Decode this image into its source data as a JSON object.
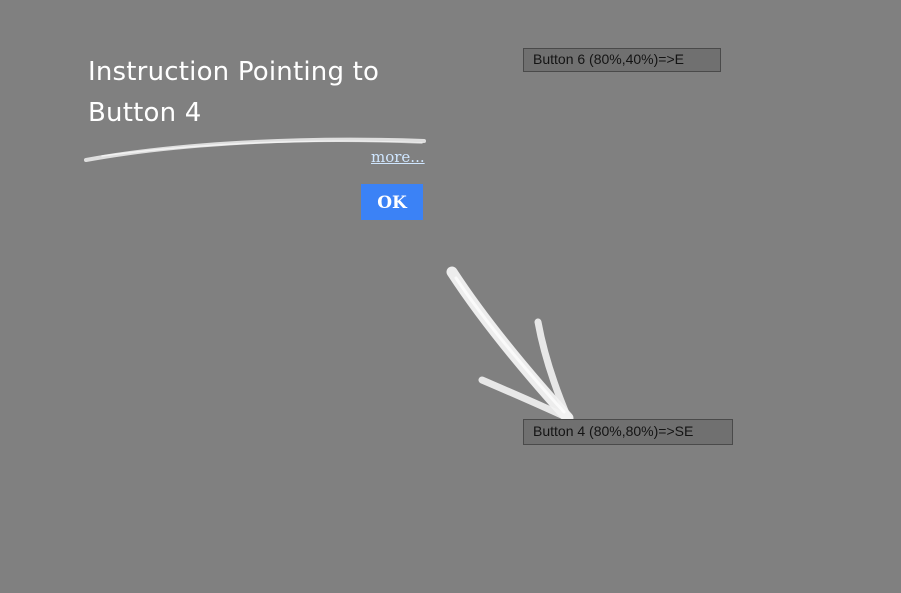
{
  "buttons": {
    "button6_label": "Button 6 (80%,40%)=>E",
    "button4_label": "Button 4 (80%,80%)=>SE"
  },
  "instruction": {
    "text": "Instruction Pointing to Button 4",
    "more_label": "more...",
    "ok_label": "OK"
  },
  "colors": {
    "background": "#808080",
    "ok_button": "#3b82f6",
    "text": "#ffffff"
  }
}
